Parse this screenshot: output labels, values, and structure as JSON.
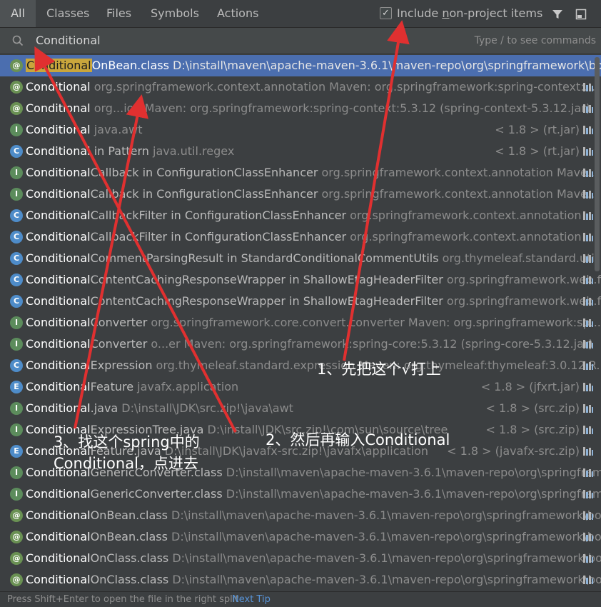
{
  "tabs": [
    "All",
    "Classes",
    "Files",
    "Symbols",
    "Actions"
  ],
  "include": {
    "label_pre": "Include ",
    "label_ul": "n",
    "label_post": "on-project items",
    "checked": "✓"
  },
  "search": {
    "value": "Conditional",
    "hint": "Type / to see commands"
  },
  "results": [
    {
      "icon": "@",
      "type": "anno",
      "name": "ConditionalOnBean.class",
      "loc": " D:\\install\\maven\\apache-maven-3.6.1\\maven-repo\\org\\springframework\\boot\\sp",
      "right": ""
    },
    {
      "icon": "@",
      "type": "anno",
      "name": "Conditional",
      "loc": " org.springframework.context.annotation   Maven: org.springframework:spring-context:...",
      "right": ""
    },
    {
      "icon": "@",
      "type": "anno",
      "name": "Conditional",
      "loc": " org...ion      Maven: org.springframework:spring-context:5.3.12 (spring-context-5.3.12.jar)",
      "right": ""
    },
    {
      "icon": "I",
      "type": "iface",
      "name": "Conditional",
      "loc": " java.awt",
      "right": "< 1.8 > (rt.jar)"
    },
    {
      "icon": "C",
      "type": "cls",
      "name": "Conditional in Pattern",
      "loc": " java.util.regex",
      "right": "< 1.8 > (rt.jar)"
    },
    {
      "icon": "I",
      "type": "iface",
      "name": "ConditionalCallback in ConfigurationClassEnhancer",
      "loc": " org.springframework.context.annotation   Mave...",
      "right": ""
    },
    {
      "icon": "I",
      "type": "iface",
      "name": "ConditionalCallback in ConfigurationClassEnhancer",
      "loc": " org.springframework.context.annotation   Mave...",
      "right": ""
    },
    {
      "icon": "C",
      "type": "cls",
      "name": "ConditionalCallbackFilter in ConfigurationClassEnhancer",
      "loc": " org.springframework.context.annotation",
      "right": ""
    },
    {
      "icon": "C",
      "type": "cls",
      "name": "ConditionalCallbackFilter in ConfigurationClassEnhancer",
      "loc": " org.springframework.context.annotation",
      "right": ""
    },
    {
      "icon": "C",
      "type": "cls",
      "name": "ConditionalCommentParsingResult in StandardConditionalCommentUtils",
      "loc": " org.thymeleaf.standard.util",
      "right": ""
    },
    {
      "icon": "C",
      "type": "cls",
      "name": "ConditionalContentCachingResponseWrapper in ShallowEtagHeaderFilter",
      "loc": " org.springframework.web.filter",
      "right": ""
    },
    {
      "icon": "C",
      "type": "cls",
      "name": "ConditionalContentCachingResponseWrapper in ShallowEtagHeaderFilter",
      "loc": " org.springframework.web.filter",
      "right": ""
    },
    {
      "icon": "I",
      "type": "iface",
      "name": "ConditionalConverter",
      "loc": " org.springframework.core.convert.converter   Maven: org.springframework:sp...",
      "right": ""
    },
    {
      "icon": "I",
      "type": "iface",
      "name": "ConditionalConverter",
      "loc": " o...er      Maven: org.springframework:spring-core:5.3.12 (spring-core-5.3.12.jar)",
      "right": ""
    },
    {
      "icon": "C",
      "type": "cls",
      "name": "ConditionalExpression",
      "loc": " org.thymeleaf.standard.expression   Maven: org.thymeleaf:thymeleaf:3.0.12.R...",
      "right": ""
    },
    {
      "icon": "E",
      "type": "enum",
      "name": "ConditionalFeature",
      "loc": " javafx.application",
      "right": "< 1.8 > (jfxrt.jar)"
    },
    {
      "icon": "I",
      "type": "iface",
      "name": "Conditional.java",
      "loc": " D:\\install\\JDK\\src.zip!\\java\\awt",
      "right": "< 1.8 > (src.zip)"
    },
    {
      "icon": "I",
      "type": "iface",
      "name": "ConditionalExpressionTree.java",
      "loc": " D:\\install\\JDK\\src.zip!\\com\\sun\\source\\tree",
      "right": "< 1.8 > (src.zip)"
    },
    {
      "icon": "E",
      "type": "enum",
      "name": "ConditionalFeature.java",
      "loc": " D:\\install\\JDK\\javafx-src.zip!\\javafx\\application",
      "right": "< 1.8 > (javafx-src.zip)"
    },
    {
      "icon": "I",
      "type": "iface",
      "name": "ConditionalGenericConverter.class",
      "loc": " D:\\install\\maven\\apache-maven-3.6.1\\maven-repo\\org\\springframewo",
      "right": ""
    },
    {
      "icon": "I",
      "type": "iface",
      "name": "ConditionalGenericConverter.class",
      "loc": " D:\\install\\maven\\apache-maven-3.6.1\\maven-repo\\org\\springframewo",
      "right": ""
    },
    {
      "icon": "@",
      "type": "anno",
      "name": "ConditionalOnBean.class",
      "loc": " D:\\install\\maven\\apache-maven-3.6.1\\maven-repo\\org\\springframework\\boot\\s",
      "right": ""
    },
    {
      "icon": "@",
      "type": "anno",
      "name": "ConditionalOnBean.class",
      "loc": " D:\\install\\maven\\apache-maven-3.6.1\\maven-repo\\org\\springframework\\boot\\s",
      "right": ""
    },
    {
      "icon": "@",
      "type": "anno",
      "name": "ConditionalOnClass.class",
      "loc": " D:\\install\\maven\\apache-maven-3.6.1\\maven-repo\\org\\springframework\\boot\\s",
      "right": ""
    },
    {
      "icon": "@",
      "type": "anno",
      "name": "ConditionalOnClass.class",
      "loc": " D:\\install\\maven\\apache-maven-3.6.1\\maven-repo\\org\\springframework\\boot\\s",
      "right": ""
    }
  ],
  "footer": {
    "text": "Press Shift+Enter to open the file in the right split",
    "tip": "Next Tip"
  },
  "annotations": {
    "a1": "1、先把这个√打上",
    "a2": "2、然后再输入Conditional",
    "a3_line1": "3、找这个spring中的",
    "a3_line2": "Conditional，点进去"
  },
  "colors": {
    "selected": "#4b6eaf",
    "highlight": "#c9a63c",
    "arrow": "#e03030"
  }
}
